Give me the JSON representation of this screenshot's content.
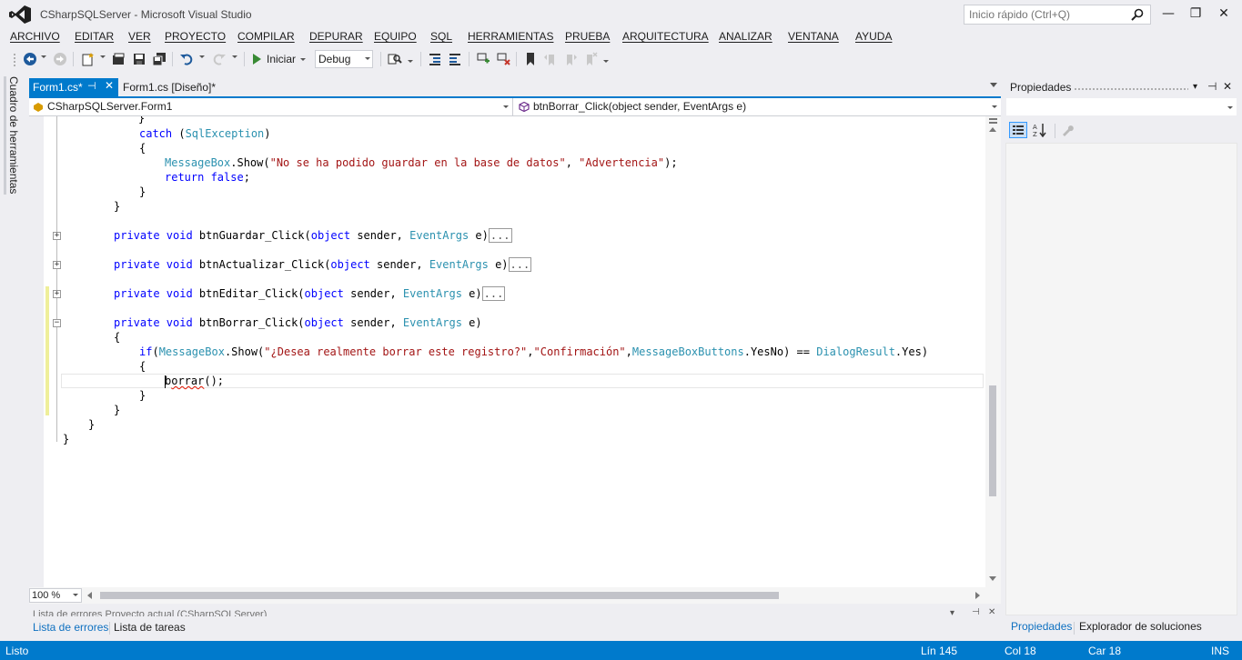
{
  "window": {
    "title": "CSharpSQLServer - Microsoft Visual Studio",
    "quick_launch_placeholder": "Inicio rápido (Ctrl+Q)",
    "minimize_glyph": "—",
    "maximize_glyph": "❐",
    "close_glyph": "✕"
  },
  "menu": {
    "items": [
      "ARCHIVO",
      "EDITAR",
      "VER",
      "PROYECTO",
      "COMPILAR",
      "DEPURAR",
      "EQUIPO",
      "SQL",
      "HERRAMIENTAS",
      "PRUEBA",
      "ARQUITECTURA",
      "ANALIZAR",
      "VENTANA",
      "AYUDA"
    ]
  },
  "toolbar": {
    "start_label": "Iniciar",
    "configuration": "Debug"
  },
  "toolbox": {
    "label": "Cuadro de herramientas"
  },
  "tabs": {
    "active": "Form1.cs*",
    "designer": "Form1.cs [Diseño]*",
    "pin_glyph": "⊣",
    "close_glyph": "✕"
  },
  "navbar": {
    "class_combo": "CSharpSQLServer.Form1",
    "member_combo": "btnBorrar_Click(object sender, EventArgs e)"
  },
  "editor": {
    "zoom": "100 %",
    "lines": {
      "l1": "}",
      "l2_kw": "catch",
      "l2_a": " (",
      "l2_ty": "SqlException",
      "l2_b": ")",
      "l3": "{",
      "l4_ty": "MessageBox",
      "l4_a": ".Show(",
      "l4_s1": "\"No se ha podido guardar en la base de datos\"",
      "l4_b": ", ",
      "l4_s2": "\"Advertencia\"",
      "l4_c": ");",
      "l5_kw": "return false",
      "l5_a": ";",
      "l6": "}",
      "l7": "}",
      "m1_kw": "private void",
      "m1_a": " btnGuardar_Click(",
      "m1_kw2": "object",
      "m1_b": " sender, ",
      "m1_ty": "EventArgs",
      "m1_c": " e)",
      "m2_kw": "private void",
      "m2_a": " btnActualizar_Click(",
      "m2_kw2": "object",
      "m2_b": " sender, ",
      "m2_ty": "EventArgs",
      "m2_c": " e)",
      "m3_kw": "private void",
      "m3_a": " btnEditar_Click(",
      "m3_kw2": "object",
      "m3_b": " sender, ",
      "m3_ty": "EventArgs",
      "m3_c": " e)",
      "m4_kw": "private void",
      "m4_a": " btnBorrar_Click(",
      "m4_kw2": "object",
      "m4_b": " sender, ",
      "m4_ty": "EventArgs",
      "m4_c": " e)",
      "collapsed": "...",
      "b1": "{",
      "if_kw": "if",
      "if_a": "(",
      "if_ty1": "MessageBox",
      "if_b": ".Show(",
      "if_s1": "\"¿Desea realmente borrar este registro?\"",
      "if_c": ",",
      "if_s2": "\"Confirmación\"",
      "if_d": ",",
      "if_ty2": "MessageBoxButtons",
      "if_e": ".YesNo) == ",
      "if_ty3": "DialogResult",
      "if_f": ".Yes)",
      "b2": "{",
      "call_pre": "b",
      "call_squig": "orrar",
      "call_post": "();",
      "b3": "}",
      "b4": "}",
      "b5": "}",
      "b6": "}"
    }
  },
  "bottom_panel": {
    "title": "Lista de errores    Proyecto actual (CSharpSQLServer)",
    "tab_errors": "Lista de errores",
    "tab_tasks": "Lista de tareas"
  },
  "properties": {
    "title": "Propiedades",
    "dropdown_glyph": "▾",
    "pin_glyph": "⊣",
    "close_glyph": "✕",
    "tab_properties": "Propiedades",
    "tab_solution": "Explorador de soluciones"
  },
  "status": {
    "state": "Listo",
    "line": "Lín 145",
    "col": "Col 18",
    "char": "Car 18",
    "mode": "INS"
  },
  "colors": {
    "accent": "#007acc",
    "keyword": "#0000ff",
    "type": "#2b91af",
    "string": "#a31515",
    "chrome": "#eeeef2"
  }
}
